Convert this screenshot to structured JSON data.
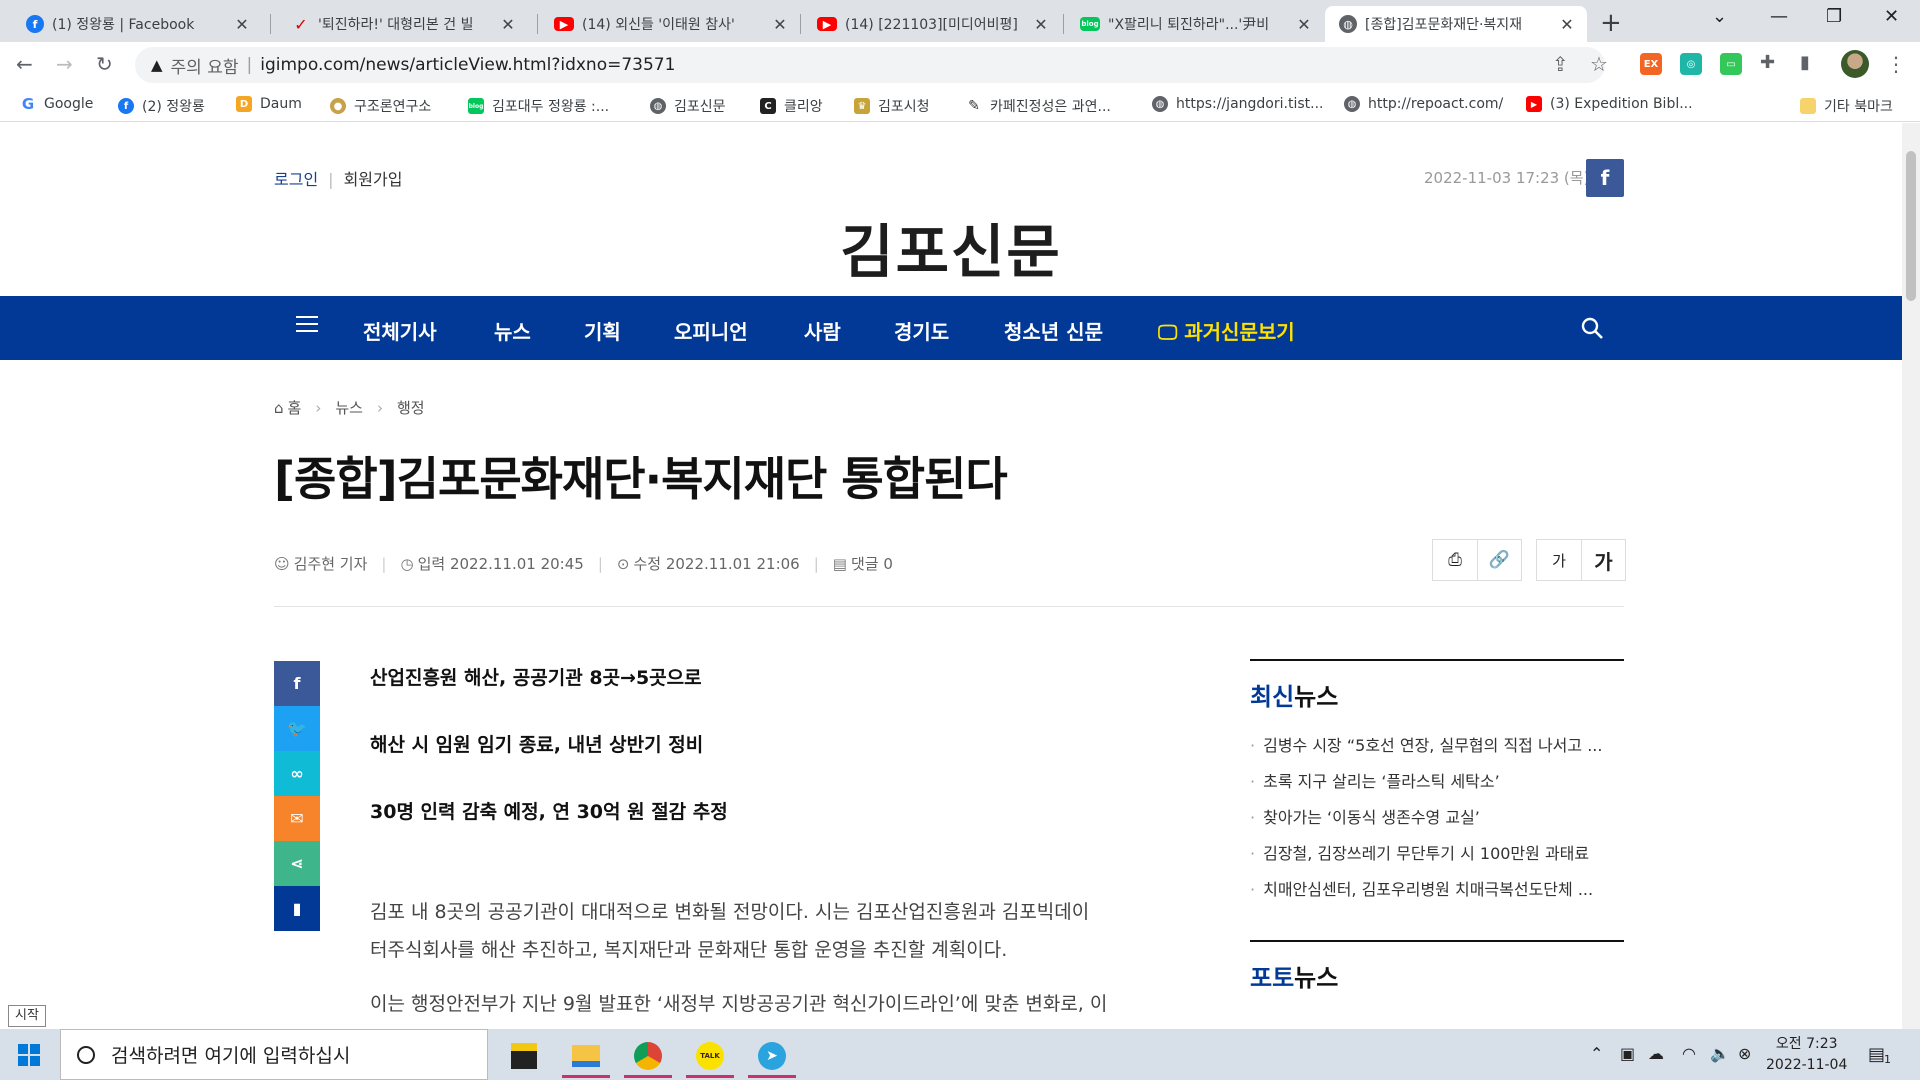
{
  "browser": {
    "tabs": [
      {
        "icon": "facebook-icon",
        "title": "(1) 정왕룡 | Facebook"
      },
      {
        "icon": "news-swoosh-icon",
        "title": "'퇴진하라!' 대형리본 건 빌"
      },
      {
        "icon": "youtube-icon",
        "title": "(14) 외신들 '이태원 참사' "
      },
      {
        "icon": "youtube-icon",
        "title": "(14) [221103][미디어비평]"
      },
      {
        "icon": "blog-icon",
        "title": "\"X팔리니 퇴진하라\"...'尹비"
      },
      {
        "icon": "globe-icon",
        "title": "[종합]김포문화재단·복지재"
      }
    ],
    "active_tab": 5,
    "security_label": "주의 요함",
    "url": "igimpo.com/news/articleView.html?idxno=73571",
    "bookmarks": [
      {
        "icon": "google-icon",
        "label": "Google",
        "color": "#4285f4"
      },
      {
        "icon": "facebook-icon",
        "label": "(2) 정왕룡",
        "color": "#1877f2"
      },
      {
        "icon": "daum-icon",
        "label": "Daum",
        "color": "#f5a623"
      },
      {
        "icon": "medal-icon",
        "label": "구조론연구소",
        "color": "#c8a24a"
      },
      {
        "icon": "blog-icon",
        "label": "김포대두 정왕룡 :...",
        "color": "#03c75a"
      },
      {
        "icon": "globe-icon",
        "label": "김포신문",
        "color": "#5f6368"
      },
      {
        "icon": "c-square-icon",
        "label": "클리앙",
        "color": "#222222"
      },
      {
        "icon": "crown-icon",
        "label": "김포시청",
        "color": "#c7a33b"
      },
      {
        "icon": "pen-icon",
        "label": "카페진정성은 과연...",
        "color": "#333333"
      },
      {
        "icon": "globe-icon",
        "label": "https://jangdori.tist...",
        "color": "#5f6368"
      },
      {
        "icon": "globe-icon",
        "label": "http://repoact.com/",
        "color": "#5f6368"
      },
      {
        "icon": "youtube-icon",
        "label": "(3) Expedition Bibl...",
        "color": "#ff0000"
      }
    ],
    "other_bookmarks": "기타 북마크"
  },
  "site": {
    "login": "로그인",
    "signup": "회원가입",
    "datetime": "2022-11-03 17:23 (목)",
    "logo": "김포신문",
    "nav": [
      "전체기사",
      "뉴스",
      "기획",
      "오피니언",
      "사람",
      "경기도",
      "청소년 신문",
      "과거신문보기"
    ],
    "brand_color": "#023997",
    "highlight_color": "#ffe100"
  },
  "article": {
    "breadcrumb": [
      "홈",
      "뉴스",
      "행정"
    ],
    "title": "[종합]김포문화재단·복지재단 통합된다",
    "author": "김주현 기자",
    "input_date": "입력 2022.11.01 20:45",
    "modified_date": "수정 2022.11.01 21:06",
    "comments": "댓글 0",
    "font_small": "가",
    "font_large": "가",
    "subtitles": [
      "산업진흥원 해산, 공공기관 8곳→5곳으로",
      "해산 시 임원 임기 종료, 내년 상반기 정비",
      "30명 인력 감축 예정, 연 30억 원 절감 추정"
    ],
    "paragraph1_line1": "김포 내 8곳의 공공기관이 대대적으로 변화될 전망이다. 시는 김포산업진흥원과 김포빅데이",
    "paragraph1_line2": "터주식회사를 해산 추진하고, 복지재단과 문화재단 통합 운영을 추진할 계획이다.",
    "paragraph2_line1": "이는 행정안전부가 지난 9월 발표한 ‘새정부 지방공공기관 혁신가이드라인’에 맞춘 변화로, 이"
  },
  "sidebar": {
    "latest_accent": "최신",
    "latest_rest": "뉴스",
    "latest": [
      "김병수 시장 “5호선 연장, 실무협의 직접 나서고 ...",
      "초록 지구 살리는 ‘플라스틱 세탁소’",
      "찾아가는 ‘이동식 생존수영 교실’",
      "김장철, 김장쓰레기 무단투기 시 100만원 과태료",
      "치매안심센터, 김포우리병원 치매극복선도단체 ..."
    ],
    "photo_accent": "포토",
    "photo_rest": "뉴스"
  },
  "taskbar": {
    "start_tooltip": "시작",
    "search_placeholder": "검색하려면 여기에 입력하십시",
    "clock_time": "오전 7:23",
    "clock_date": "2022-11-04",
    "notification_count": "1"
  }
}
